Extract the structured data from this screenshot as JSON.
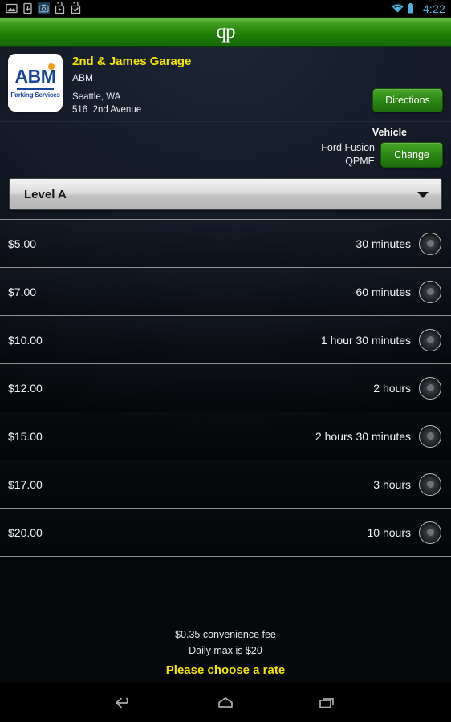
{
  "statusbar": {
    "icons": [
      "image-icon",
      "download-icon",
      "screenshot-icon",
      "play-store-icon",
      "checkbox-bag-icon"
    ],
    "wifi_icon": "wifi-icon",
    "battery_icon": "battery-icon",
    "time": "4:22",
    "time_color": "#4fb3d9"
  },
  "appbar": {
    "logo_text": "qp",
    "background_top": "#6fc44a",
    "background_bottom": "#17690a"
  },
  "garage": {
    "logo": {
      "brand": "ABM",
      "tagline": "Parking Services",
      "brand_color": "#16459b",
      "dot_color": "#f59b12"
    },
    "name": "2nd & James Garage",
    "name_color": "#f2e500",
    "operator": "ABM",
    "city": "Seattle, WA",
    "address": "516  2nd Avenue",
    "directions_label": "Directions"
  },
  "vehicle": {
    "title": "Vehicle",
    "make": "Ford Fusion",
    "plate": "QPME",
    "change_label": "Change"
  },
  "level_selector": {
    "selected": "Level A",
    "options": [
      "Level A"
    ]
  },
  "rates": [
    {
      "price": "$5.00",
      "duration": "30 minutes",
      "selected": false
    },
    {
      "price": "$7.00",
      "duration": "60 minutes",
      "selected": false
    },
    {
      "price": "$10.00",
      "duration": "1 hour 30 minutes",
      "selected": false
    },
    {
      "price": "$12.00",
      "duration": "2 hours",
      "selected": false
    },
    {
      "price": "$15.00",
      "duration": "2 hours 30 minutes",
      "selected": false
    },
    {
      "price": "$17.00",
      "duration": "3 hours",
      "selected": false
    },
    {
      "price": "$20.00",
      "duration": "10 hours",
      "selected": false
    }
  ],
  "footer": {
    "convenience_fee": "$0.35 convenience fee",
    "daily_max": "Daily max is $20",
    "prompt": "Please choose a rate",
    "prompt_color": "#f2e500"
  },
  "navbar": {
    "back_label": "back-icon",
    "home_label": "home-icon",
    "recents_label": "recents-icon"
  }
}
